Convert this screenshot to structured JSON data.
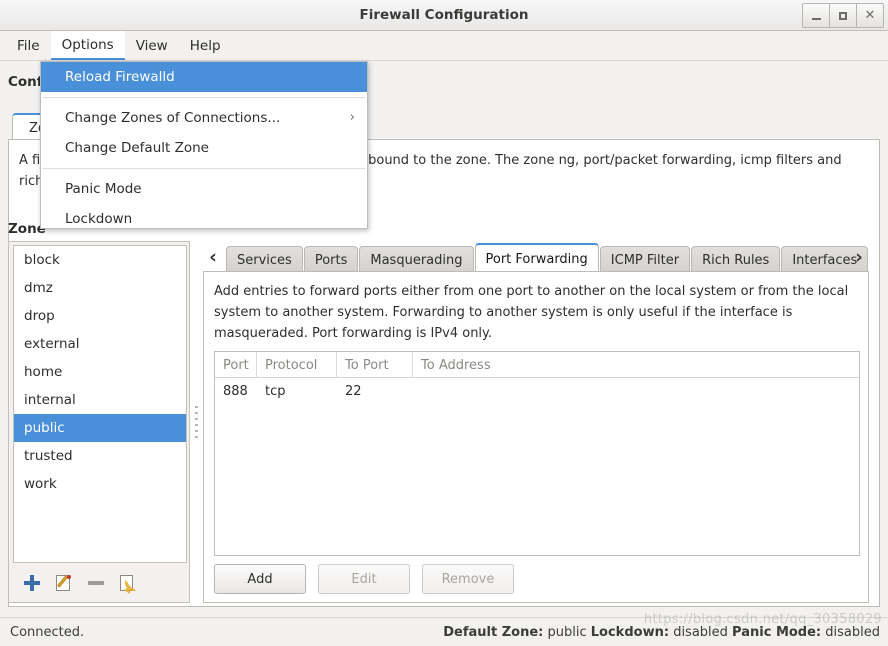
{
  "window": {
    "title": "Firewall Configuration",
    "buttons": {
      "minimize": "minimize",
      "maximize": "maximize",
      "close": "close"
    }
  },
  "menubar": {
    "items": [
      {
        "label": "File",
        "active": false
      },
      {
        "label": "Options",
        "active": true
      },
      {
        "label": "View",
        "active": false
      },
      {
        "label": "Help",
        "active": false
      }
    ]
  },
  "options_menu": {
    "items": [
      {
        "label": "Reload Firewalld",
        "highlighted": true,
        "submenu": false
      },
      {
        "label": "Change Zones of Connections...",
        "highlighted": false,
        "submenu": true,
        "arrow": "›"
      },
      {
        "label": "Change Default Zone",
        "highlighted": false,
        "submenu": false
      },
      {
        "label": "Panic Mode",
        "highlighted": false,
        "submenu": false
      },
      {
        "label": "Lockdown",
        "highlighted": false,
        "submenu": false
      }
    ]
  },
  "main": {
    "configuration_label": "Conf",
    "top_tab_label": "Zo",
    "zone_description": "A fir                                                      rk connections, interfaces and source addresses bound to the zone. The zone                                                   ng, port/packet forwarding, icmp filters and rich rules. The zone can be boun",
    "zone_header": "Zone"
  },
  "zone_list": {
    "items": [
      {
        "label": "block",
        "selected": false
      },
      {
        "label": "dmz",
        "selected": false
      },
      {
        "label": "drop",
        "selected": false
      },
      {
        "label": "external",
        "selected": false
      },
      {
        "label": "home",
        "selected": false
      },
      {
        "label": "internal",
        "selected": false
      },
      {
        "label": "public",
        "selected": true
      },
      {
        "label": "trusted",
        "selected": false
      },
      {
        "label": "work",
        "selected": false
      }
    ],
    "toolbar": [
      {
        "name": "add-zone-icon"
      },
      {
        "name": "edit-zone-icon"
      },
      {
        "name": "remove-zone-icon"
      },
      {
        "name": "load-default-zone-icon"
      }
    ]
  },
  "tabs": {
    "prev_arrow": "‹",
    "next_arrow": "›",
    "items": [
      {
        "label": "Services",
        "active": false
      },
      {
        "label": "Ports",
        "active": false
      },
      {
        "label": "Masquerading",
        "active": false
      },
      {
        "label": "Port Forwarding",
        "active": true
      },
      {
        "label": "ICMP Filter",
        "active": false
      },
      {
        "label": "Rich Rules",
        "active": false
      },
      {
        "label": "Interfaces",
        "active": false
      }
    ]
  },
  "port_forwarding": {
    "description": "Add entries to forward ports either from one port to another on the local system or from the local system to another system. Forwarding to another system is only useful if the interface is masqueraded. Port forwarding is IPv4 only.",
    "columns": [
      "Port",
      "Protocol",
      "To Port",
      "To Address"
    ],
    "rows": [
      {
        "port": "888",
        "protocol": "tcp",
        "to_port": "22",
        "to_address": ""
      }
    ],
    "buttons": [
      {
        "label": "Add",
        "enabled": true
      },
      {
        "label": "Edit",
        "enabled": false
      },
      {
        "label": "Remove",
        "enabled": false
      }
    ]
  },
  "statusbar": {
    "connection": "Connected.",
    "default_zone_label": "Default Zone:",
    "default_zone_value": "public",
    "lockdown_label": "Lockdown:",
    "lockdown_value": "disabled",
    "panic_label": "Panic Mode:",
    "panic_value": "disabled",
    "watermark": "https://blog.csdn.net/qq_30358029"
  },
  "colors": {
    "accent": "#4a90d9",
    "window_bg": "#f2f1f0",
    "panel_bg": "#ffffff",
    "border": "#bfbcb8"
  }
}
